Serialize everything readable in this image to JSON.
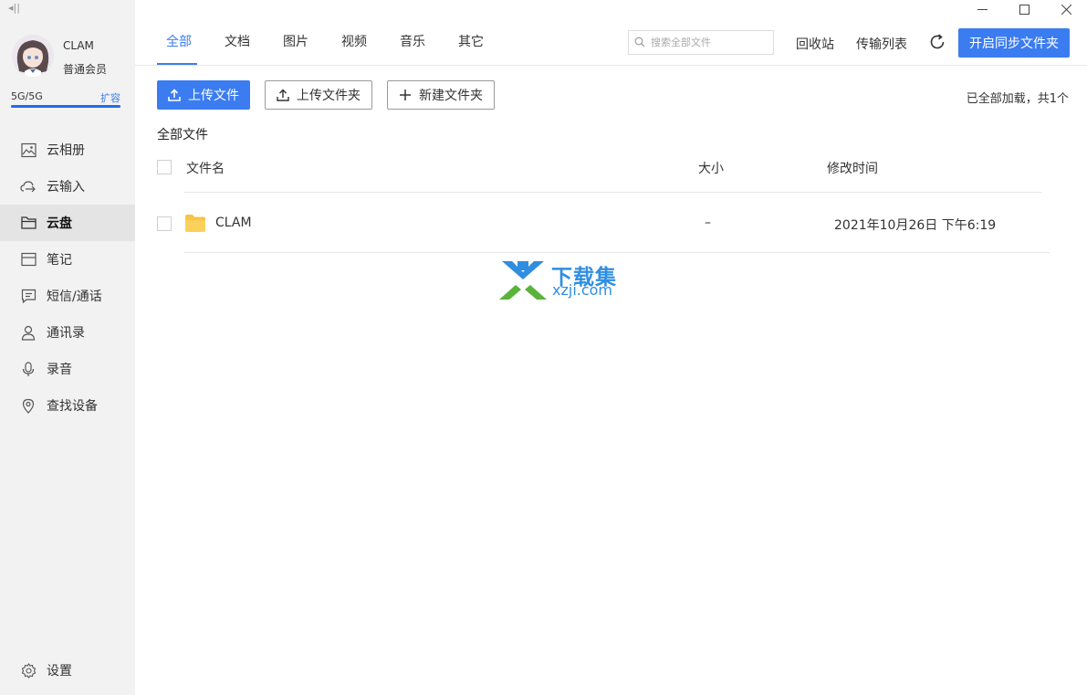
{
  "sidebar": {
    "collapse_glyph": "◂||",
    "user": {
      "name": "CLAM",
      "tier": "普通会员"
    },
    "storage": {
      "text": "5G/5G",
      "expand_label": "扩容",
      "used_fraction": 1.0
    },
    "items": [
      {
        "label": "云相册",
        "icon": "photo-icon"
      },
      {
        "label": "云输入",
        "icon": "cloud-input-icon"
      },
      {
        "label": "云盘",
        "icon": "folder-icon",
        "active": true
      },
      {
        "label": "笔记",
        "icon": "note-icon"
      },
      {
        "label": "短信/通话",
        "icon": "message-icon"
      },
      {
        "label": "通讯录",
        "icon": "contact-icon"
      },
      {
        "label": "录音",
        "icon": "microphone-icon"
      },
      {
        "label": "查找设备",
        "icon": "location-icon"
      }
    ],
    "settings_label": "设置"
  },
  "tabs": [
    {
      "label": "全部",
      "active": true
    },
    {
      "label": "文档"
    },
    {
      "label": "图片"
    },
    {
      "label": "视频"
    },
    {
      "label": "音乐"
    },
    {
      "label": "其它"
    }
  ],
  "header": {
    "search_placeholder": "搜索全部文件",
    "recycle_label": "回收站",
    "transfer_label": "传输列表",
    "sync_button": "开启同步文件夹"
  },
  "actions": {
    "upload_file": "上传文件",
    "upload_folder": "上传文件夹",
    "new_folder": "新建文件夹",
    "loaded_note": "已全部加载，共1个"
  },
  "breadcrumb": "全部文件",
  "table": {
    "columns": {
      "name": "文件名",
      "size": "大小",
      "modified": "修改时间"
    },
    "rows": [
      {
        "name": "CLAM",
        "size": "–",
        "modified": "2021年10月26日 下午6:19",
        "type": "folder"
      }
    ]
  },
  "watermark": {
    "line1": "下载集",
    "line2": "xzji.com"
  },
  "colors": {
    "accent": "#3b7cf0",
    "folder": "#f8c443",
    "sidebar_bg": "#f2f2f2"
  }
}
